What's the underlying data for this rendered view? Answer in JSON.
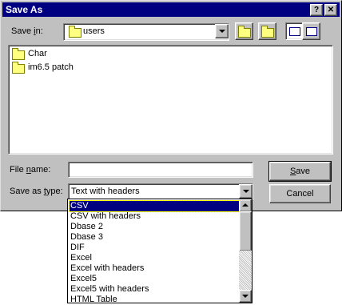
{
  "window": {
    "title": "Save As",
    "help_glyph": "?",
    "close_glyph": "✕"
  },
  "save_in": {
    "label_pre": "Save ",
    "label_u": "i",
    "label_post": "n:",
    "value": "users"
  },
  "files": [
    {
      "name": "Char",
      "icon": "folder-icon"
    },
    {
      "name": "im6.5 patch",
      "icon": "folder-icon"
    }
  ],
  "file_name": {
    "label_pre": "File ",
    "label_u": "n",
    "label_post": "ame:",
    "value": ""
  },
  "save_as_type": {
    "label_pre": "Save as ",
    "label_u": "t",
    "label_post": "ype:",
    "value": "Text with headers"
  },
  "buttons": {
    "save_u": "S",
    "save_rest": "ave",
    "cancel": "Cancel"
  },
  "type_options": [
    "CSV",
    "CSV with headers",
    "Dbase 2",
    "Dbase 3",
    "DIF",
    "Excel",
    "Excel with headers",
    "Excel5",
    "Excel5 with headers",
    "HTML Table"
  ],
  "selected_option": "CSV",
  "colors": {
    "titlebar": "#000080",
    "face": "#c0c0c0",
    "selection": "#000080"
  }
}
